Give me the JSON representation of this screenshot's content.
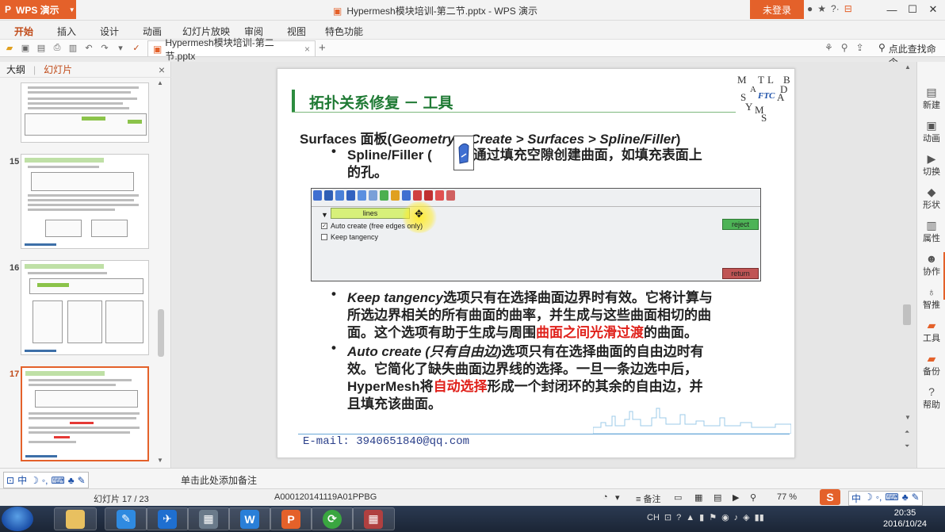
{
  "titlebar": {
    "app_name": "WPS 演示",
    "doc_title": "Hypermesh模块培训-第二节.pptx - WPS 演示",
    "login_label": "未登录",
    "title_icons": [
      "●",
      "★",
      "?·",
      "—"
    ]
  },
  "menubar": {
    "tabs": [
      "开始",
      "插入",
      "设计",
      "动画",
      "幻灯片放映",
      "审阅",
      "视图",
      "特色功能"
    ]
  },
  "toolbar": {
    "doc_tab_label": "Hypermesh模块培训-第二节.pptx",
    "search_cmd_label": "点此查找命令"
  },
  "left_panel": {
    "tab_outline": "大纲",
    "tab_slides": "幻灯片",
    "slide_numbers": [
      "15",
      "16",
      "17"
    ]
  },
  "slide": {
    "title": "拓扑关系修复 － 工具",
    "logo_letters": [
      "M",
      "A",
      "T",
      "L",
      "A",
      "B",
      "S",
      "Y",
      "M",
      "S",
      "D"
    ],
    "logo_center": "FTC",
    "surfaces_prefix": "Surfaces 面板(",
    "surfaces_path": "Geometry > Create > Surfaces > Spline/Filler",
    "surfaces_suffix": ")",
    "spline_label": "Spline/Filler (",
    "spline_desc": "): 通过填充空隙创建曲面，如填充表面上",
    "spline_desc2": "的孔。",
    "panel": {
      "selector_label": "lines",
      "auto_create_label": "Auto create (free edges only)",
      "keep_tangency_label": "Keep tangency",
      "reject_label": "reject",
      "return_label": "return"
    },
    "kt_line1_em": "Keep tangency",
    "kt_line1_rest": "选项只有在选择曲面边界时有效。它将计算与",
    "kt_line2": "所选边界相关的所有曲面的曲率，并生成与这些曲面相切的曲",
    "kt_line3_pre": "面。这个选项有助于生成与周围",
    "kt_line3_red": "曲面之间光滑过渡",
    "kt_line3_post": "的曲面。",
    "ac_line1_em": "Auto create (只有自由边)",
    "ac_line1_rest": "选项只有在选择曲面的自由边时有",
    "ac_line2": "效。它简化了缺失曲面边界线的选择。一旦一条边选中后，",
    "ac_line3_pre": "HyperMesh将",
    "ac_line3_red": "自动选择",
    "ac_line3_post": "形成一个封闭环的其余的自由边，并",
    "ac_line4": "且填充该曲面。",
    "email": "E-mail: 3940651840@qq.com"
  },
  "right_bar": {
    "items": [
      "新建",
      "动画",
      "切换",
      "形状",
      "属性",
      "协作",
      "智推",
      "工具",
      "备份",
      "帮助"
    ]
  },
  "notes": {
    "placeholder": "单击此处添加备注",
    "ime_label": "中"
  },
  "status": {
    "slide_position": "幻灯片 17 / 23",
    "template_name": "A000120141119A01PPBG",
    "notes_label": "备注",
    "zoom": "77 %",
    "ime_right": "中"
  },
  "taskbar": {
    "tray_lang": "CH",
    "time": "20:35",
    "date": "2016/10/24"
  },
  "colors": {
    "wps_orange": "#e4612a",
    "slide_green": "#1f7a34",
    "highlight_red": "#e0201a"
  }
}
